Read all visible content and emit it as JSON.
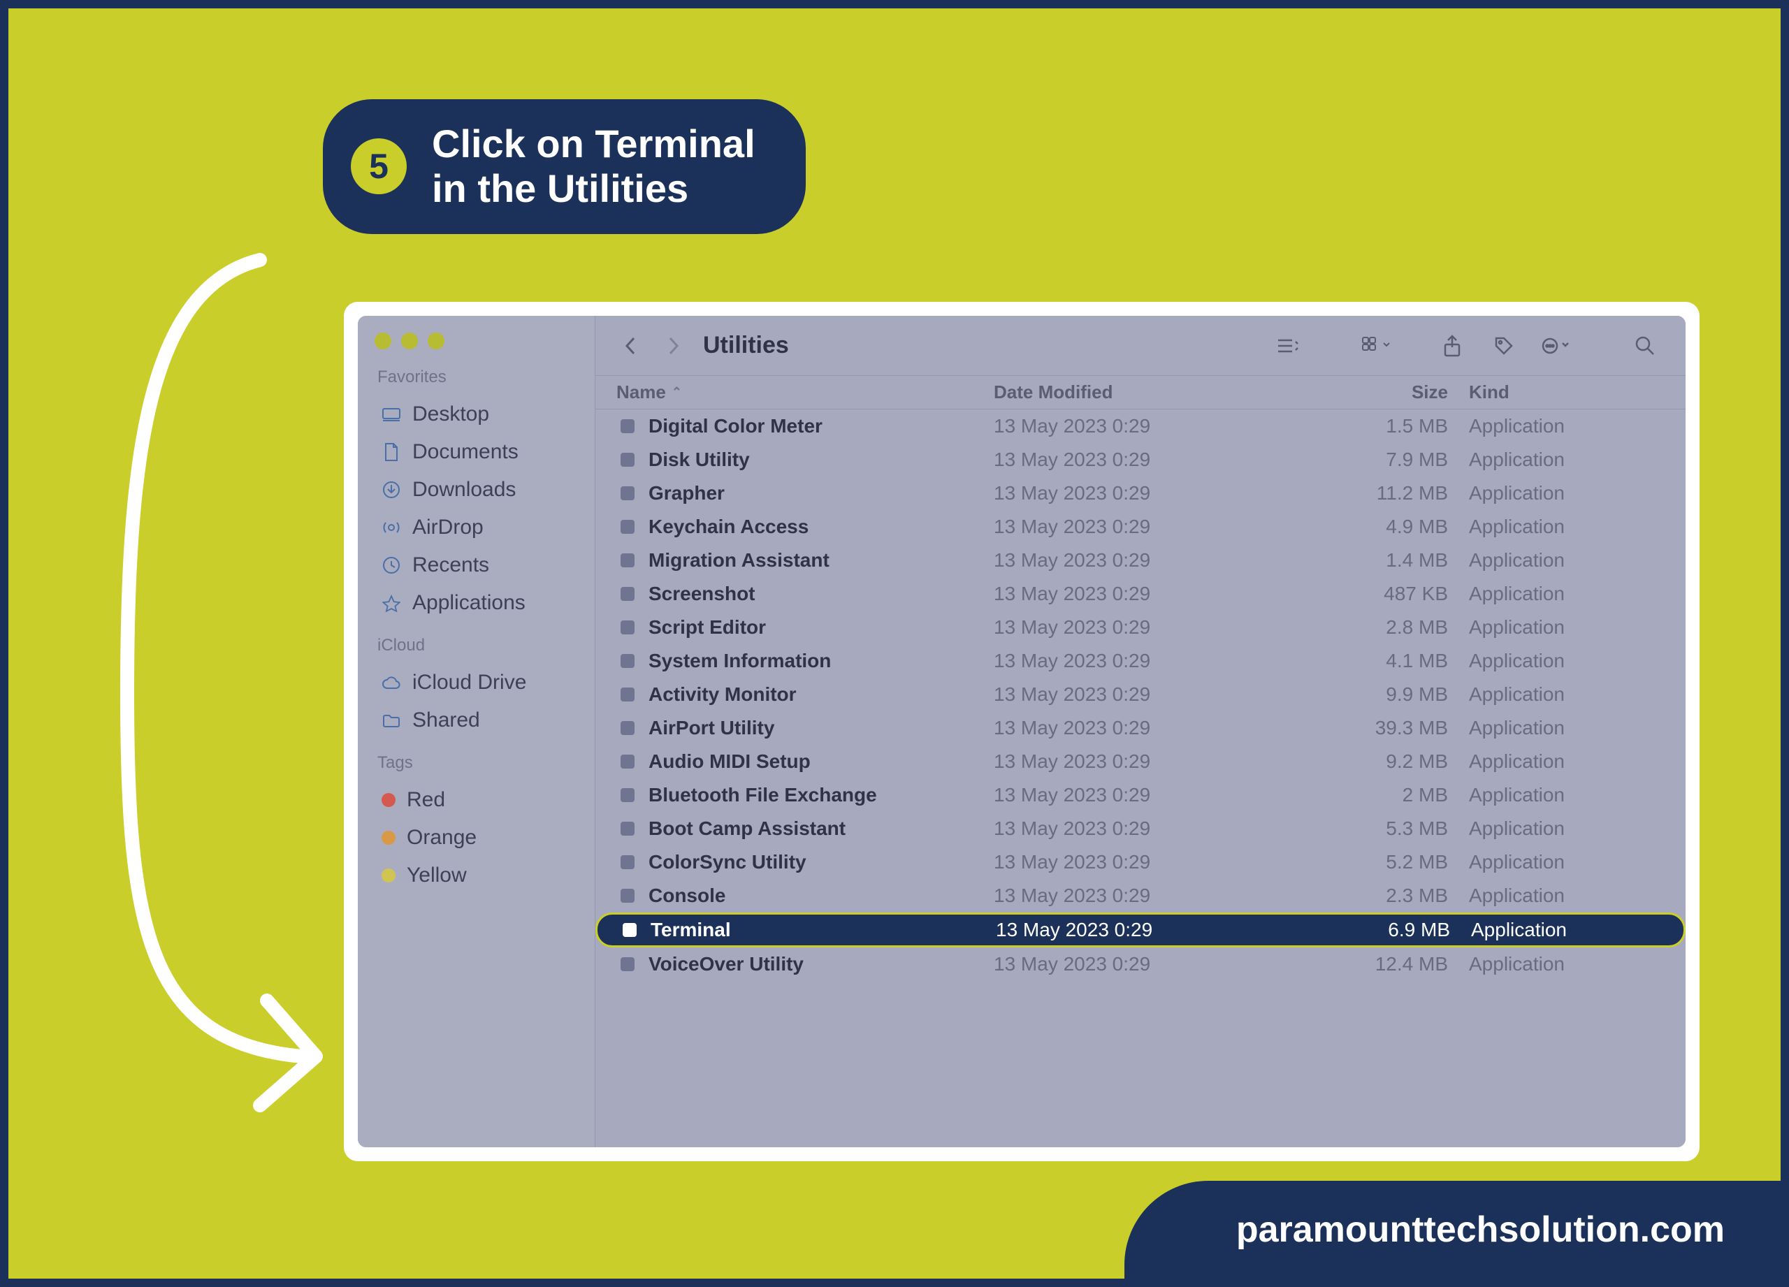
{
  "step": {
    "number": "5",
    "text_line1": "Click on Terminal",
    "text_line2": "in the Utilities"
  },
  "footer_url": "paramounttechsolution.com",
  "finder": {
    "title": "Utilities",
    "sidebar": {
      "sections": {
        "favorites_label": "Favorites",
        "icloud_label": "iCloud",
        "tags_label": "Tags"
      },
      "favorites": [
        {
          "label": "Desktop"
        },
        {
          "label": "Documents"
        },
        {
          "label": "Downloads"
        },
        {
          "label": "AirDrop"
        },
        {
          "label": "Recents"
        },
        {
          "label": "Applications"
        }
      ],
      "icloud": [
        {
          "label": "iCloud Drive"
        },
        {
          "label": "Shared"
        }
      ],
      "tags": [
        {
          "label": "Red"
        },
        {
          "label": "Orange"
        },
        {
          "label": "Yellow"
        }
      ]
    },
    "columns": {
      "name": "Name",
      "date": "Date Modified",
      "size": "Size",
      "kind": "Kind"
    },
    "rows": [
      {
        "name": "Digital Color Meter",
        "date": "13 May 2023 0:29",
        "size": "1.5 MB",
        "kind": "Application",
        "selected": false
      },
      {
        "name": "Disk Utility",
        "date": "13 May 2023 0:29",
        "size": "7.9 MB",
        "kind": "Application",
        "selected": false
      },
      {
        "name": "Grapher",
        "date": "13 May 2023 0:29",
        "size": "11.2 MB",
        "kind": "Application",
        "selected": false
      },
      {
        "name": "Keychain Access",
        "date": "13 May 2023 0:29",
        "size": "4.9 MB",
        "kind": "Application",
        "selected": false
      },
      {
        "name": "Migration Assistant",
        "date": "13 May 2023 0:29",
        "size": "1.4 MB",
        "kind": "Application",
        "selected": false
      },
      {
        "name": "Screenshot",
        "date": "13 May 2023 0:29",
        "size": "487 KB",
        "kind": "Application",
        "selected": false
      },
      {
        "name": "Script Editor",
        "date": "13 May 2023 0:29",
        "size": "2.8 MB",
        "kind": "Application",
        "selected": false
      },
      {
        "name": "System Information",
        "date": "13 May 2023 0:29",
        "size": "4.1 MB",
        "kind": "Application",
        "selected": false
      },
      {
        "name": "Activity Monitor",
        "date": "13 May 2023 0:29",
        "size": "9.9 MB",
        "kind": "Application",
        "selected": false
      },
      {
        "name": "AirPort Utility",
        "date": "13 May 2023 0:29",
        "size": "39.3 MB",
        "kind": "Application",
        "selected": false
      },
      {
        "name": "Audio MIDI Setup",
        "date": "13 May 2023 0:29",
        "size": "9.2 MB",
        "kind": "Application",
        "selected": false
      },
      {
        "name": "Bluetooth File Exchange",
        "date": "13 May 2023 0:29",
        "size": "2 MB",
        "kind": "Application",
        "selected": false
      },
      {
        "name": "Boot Camp Assistant",
        "date": "13 May 2023 0:29",
        "size": "5.3 MB",
        "kind": "Application",
        "selected": false
      },
      {
        "name": "ColorSync Utility",
        "date": "13 May 2023 0:29",
        "size": "5.2 MB",
        "kind": "Application",
        "selected": false
      },
      {
        "name": "Console",
        "date": "13 May 2023 0:29",
        "size": "2.3 MB",
        "kind": "Application",
        "selected": false
      },
      {
        "name": "Terminal",
        "date": "13 May 2023 0:29",
        "size": "6.9 MB",
        "kind": "Application",
        "selected": true
      },
      {
        "name": "VoiceOver Utility",
        "date": "13 May 2023 0:29",
        "size": "12.4 MB",
        "kind": "Application",
        "selected": false
      }
    ]
  }
}
